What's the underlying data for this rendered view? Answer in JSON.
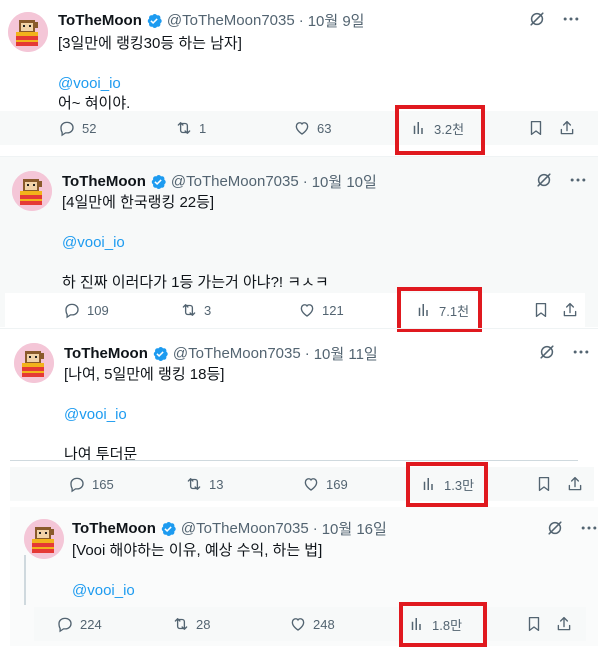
{
  "tweets": [
    {
      "name": "ToTheMoon",
      "handle": "@ToTheMoon7035",
      "date": "10월 9일",
      "line1": "[3일만에 랭킹30등 하는 남자]",
      "mention": "@vooi_io",
      "line3": "어~ 혀이야.",
      "replies": "52",
      "reposts": "1",
      "likes": "63",
      "views": "3.2천"
    },
    {
      "name": "ToTheMoon",
      "handle": "@ToTheMoon7035",
      "date": "10월 10일",
      "line1": "[4일만에 한국랭킹 22등]",
      "mention": "@vooi_io",
      "line3": "하 진짜 이러다가 1등 가는거 아냐?! ㅋㅅㅋ",
      "replies": "109",
      "reposts": "3",
      "likes": "121",
      "views": "7.1천"
    },
    {
      "name": "ToTheMoon",
      "handle": "@ToTheMoon7035",
      "date": "10월 11일",
      "line1": "[나여, 5일만에 랭킹 18등]",
      "mention": "@vooi_io",
      "line3": "나여 투더문",
      "replies": "165",
      "reposts": "13",
      "likes": "169",
      "views": "1.3만"
    },
    {
      "name": "ToTheMoon",
      "handle": "@ToTheMoon7035",
      "date": "10월 16일",
      "line1": "[Vooi 해야하는 이유, 예상 수익, 하는 법]",
      "mention": "@vooi_io",
      "replies": "224",
      "reposts": "28",
      "likes": "248",
      "views": "1.8만"
    }
  ],
  "icons": {
    "reply": "reply-icon",
    "repost": "repost-icon",
    "like": "heart-icon",
    "views": "views-chart-icon",
    "bookmark": "bookmark-icon",
    "share": "share-icon",
    "grok": "grok-icon",
    "more": "more-icon",
    "verified": "verified-badge-icon"
  },
  "colors": {
    "highlight": "#e0191f",
    "mention": "#1d9bf0",
    "verified": "#1d9bf0",
    "muted": "#536471"
  }
}
